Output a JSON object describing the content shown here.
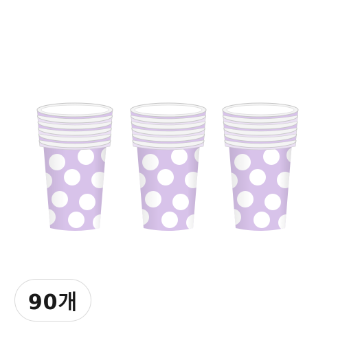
{
  "product": {
    "quantity_label": "90개",
    "cup_color": "#d8c3ea",
    "cup_dot_color": "#ffffff",
    "rim_color": "#f4f4f4",
    "stacks_shown": 3
  }
}
